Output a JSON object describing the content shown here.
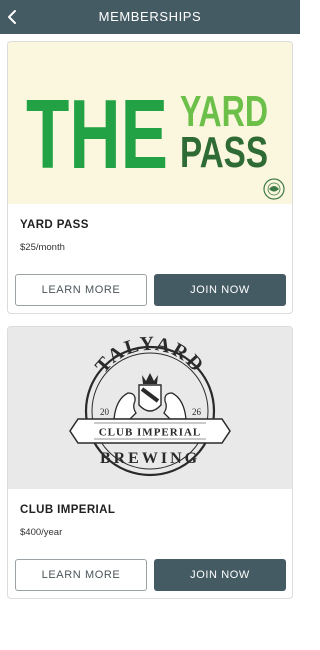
{
  "header": {
    "title": "MEMBERSHIPS",
    "back_icon": "chevron-left-icon"
  },
  "colors": {
    "header_bg": "#455b63",
    "primary_button": "#455b63",
    "brand_green": "#22a245",
    "brand_dark_green": "#2f7a3a",
    "brand_light_green": "#6cc04a"
  },
  "memberships": [
    {
      "logo": {
        "word1": "THE",
        "word2": "YARD",
        "word3": "PASS"
      },
      "name": "YARD PASS",
      "price": "$25/month",
      "learn_more_label": "LEARN MORE",
      "join_label": "JOIN NOW"
    },
    {
      "logo": {
        "top": "TALYARD",
        "band": "CLUB IMPERIAL",
        "bottom": "BREWING",
        "year_left": "20",
        "year_right": "26"
      },
      "name": "CLUB IMPERIAL",
      "price": "$400/year",
      "learn_more_label": "LEARN MORE",
      "join_label": "JOIN NOW"
    }
  ]
}
